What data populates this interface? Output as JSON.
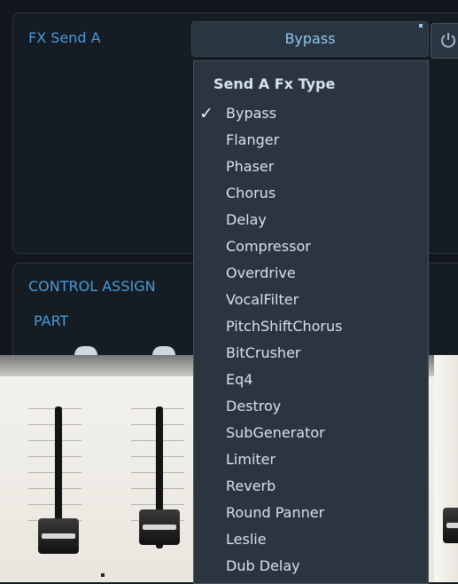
{
  "fx_section": {
    "title": "FX Send A",
    "selected_type": "Bypass"
  },
  "control_section": {
    "title": "CONTROL ASSIGN",
    "part_label": "PART"
  },
  "dropdown": {
    "header": "Send A Fx Type",
    "items": [
      {
        "label": "Bypass",
        "checked": true
      },
      {
        "label": "Flanger",
        "checked": false
      },
      {
        "label": "Phaser",
        "checked": false
      },
      {
        "label": "Chorus",
        "checked": false
      },
      {
        "label": "Delay",
        "checked": false
      },
      {
        "label": "Compressor",
        "checked": false
      },
      {
        "label": "Overdrive",
        "checked": false
      },
      {
        "label": "VocalFilter",
        "checked": false
      },
      {
        "label": "PitchShiftChorus",
        "checked": false
      },
      {
        "label": "BitCrusher",
        "checked": false
      },
      {
        "label": "Eq4",
        "checked": false
      },
      {
        "label": "Destroy",
        "checked": false
      },
      {
        "label": "SubGenerator",
        "checked": false
      },
      {
        "label": "Limiter",
        "checked": false
      },
      {
        "label": "Reverb",
        "checked": false
      },
      {
        "label": "Round Panner",
        "checked": false
      },
      {
        "label": "Leslie",
        "checked": false
      },
      {
        "label": "Dub Delay",
        "checked": false
      }
    ]
  },
  "colors": {
    "accent": "#4a9ad8",
    "panel_bg": "#161c23",
    "dropdown_bg": "#2b3540",
    "mixer_bg": "#eeeae2"
  },
  "icons": {
    "power": "power-icon",
    "check": "check-icon"
  }
}
